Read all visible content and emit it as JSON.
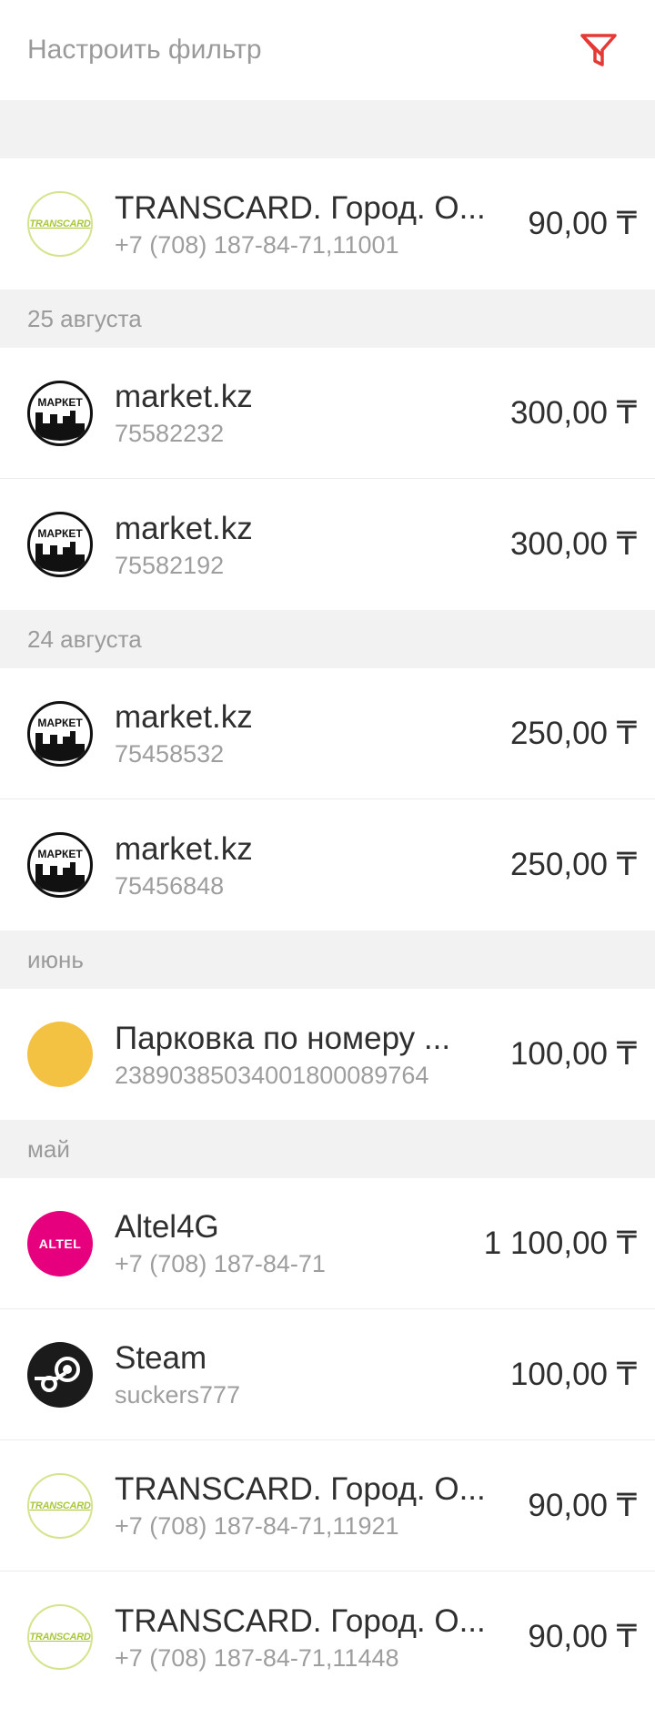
{
  "filter": {
    "label": "Настроить фильтр",
    "icon": "filter-icon",
    "icon_color": "#e53935"
  },
  "groups": [
    {
      "header": "",
      "items": [
        {
          "logo": "transcard",
          "logo_text": "TRANSCARD",
          "title": "TRANSCARD. Город. О...",
          "subtitle": "+7 (708) 187-84-71,11001",
          "amount": "90,00 ₸"
        }
      ]
    },
    {
      "header": "25 августа",
      "items": [
        {
          "logo": "market",
          "logo_text": "МАРКЕТ",
          "title": "market.kz",
          "subtitle": "75582232",
          "amount": "300,00 ₸"
        },
        {
          "logo": "market",
          "logo_text": "МАРКЕТ",
          "title": "market.kz",
          "subtitle": "75582192",
          "amount": "300,00 ₸"
        }
      ]
    },
    {
      "header": "24 августа",
      "items": [
        {
          "logo": "market",
          "logo_text": "МАРКЕТ",
          "title": "market.kz",
          "subtitle": "75458532",
          "amount": "250,00 ₸"
        },
        {
          "logo": "market",
          "logo_text": "МАРКЕТ",
          "title": "market.kz",
          "subtitle": "75456848",
          "amount": "250,00 ₸"
        }
      ]
    },
    {
      "header": "июнь",
      "items": [
        {
          "logo": "parking",
          "logo_text": "",
          "title": "Парковка по номеру ...",
          "subtitle": "23890385034001800089764",
          "amount": "100,00 ₸"
        }
      ]
    },
    {
      "header": "май",
      "items": [
        {
          "logo": "altel",
          "logo_text": "ALTEL",
          "title": "Altel4G",
          "subtitle": "+7 (708) 187-84-71",
          "amount": "1 100,00 ₸"
        },
        {
          "logo": "steam",
          "logo_text": "",
          "title": "Steam",
          "subtitle": "suckers777",
          "amount": "100,00 ₸"
        },
        {
          "logo": "transcard",
          "logo_text": "TRANSCARD",
          "title": "TRANSCARD. Город. О...",
          "subtitle": "+7 (708) 187-84-71,11921",
          "amount": "90,00 ₸"
        },
        {
          "logo": "transcard",
          "logo_text": "TRANSCARD",
          "title": "TRANSCARD. Город. О...",
          "subtitle": "+7 (708) 187-84-71,11448",
          "amount": "90,00 ₸"
        }
      ]
    }
  ]
}
